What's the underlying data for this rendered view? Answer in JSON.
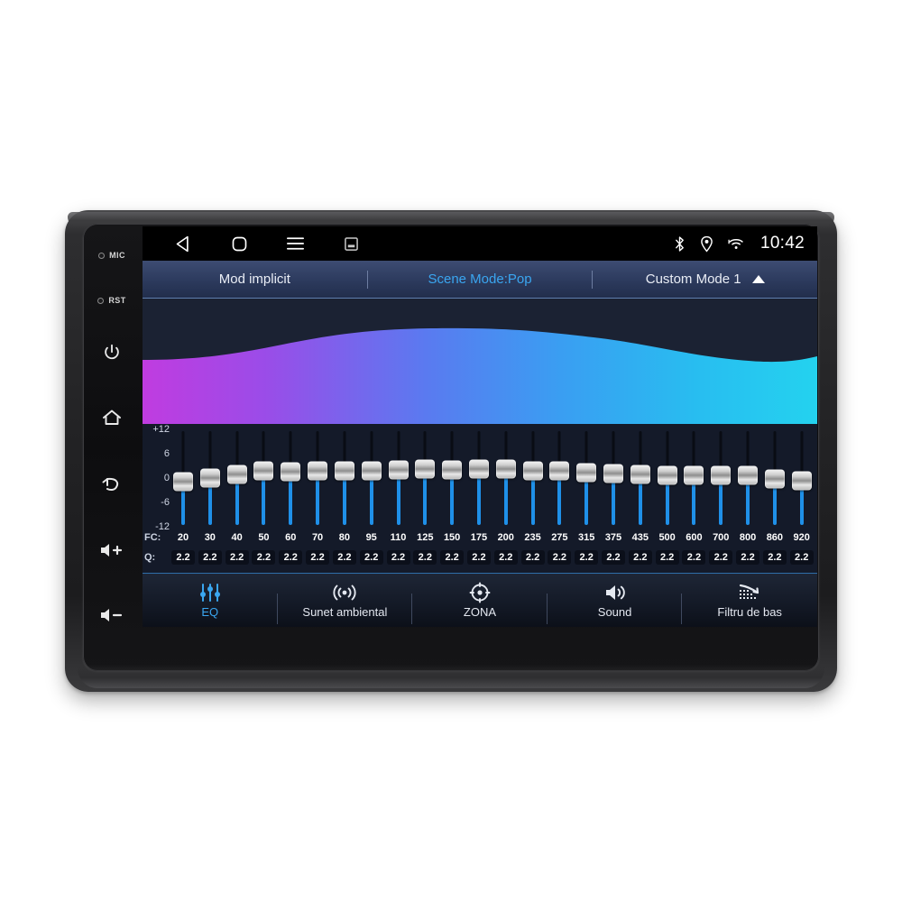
{
  "device": {
    "hardkeys": [
      {
        "name": "mic",
        "label": "MIC"
      },
      {
        "name": "reset",
        "label": "RST"
      },
      {
        "name": "power",
        "label": ""
      },
      {
        "name": "home",
        "label": ""
      },
      {
        "name": "back",
        "label": ""
      },
      {
        "name": "volume-up",
        "label": ""
      },
      {
        "name": "volume-down",
        "label": ""
      }
    ]
  },
  "status_bar": {
    "nav": [
      "back-triangle-icon",
      "home-square-icon",
      "menu-lines-icon",
      "screenshot-icon"
    ],
    "indicators": [
      "bluetooth-icon",
      "location-icon",
      "wifi-icon"
    ],
    "clock": "10:42"
  },
  "mode_bar": {
    "left_label": "Mod implicit",
    "center_label": "Scene Mode:Pop",
    "right_label": "Custom Mode 1",
    "caret": "caret-up-icon",
    "active_color": "#3aa6f0"
  },
  "spectrum": {
    "gradient_start": "#c03ce0",
    "gradient_mid": "#4f7ef0",
    "gradient_end": "#24c8ef",
    "background": "#1b2233"
  },
  "equalizer": {
    "scale_labels": [
      "+12",
      "6",
      "0",
      "-6",
      "-12"
    ],
    "fc_tag": "FC:",
    "q_tag": "Q:",
    "bands": [
      {
        "fc": "20",
        "q": "2.2",
        "gain": -1.0
      },
      {
        "fc": "30",
        "q": "2.2",
        "gain": 0.0
      },
      {
        "fc": "40",
        "q": "2.2",
        "gain": 1.0
      },
      {
        "fc": "50",
        "q": "2.2",
        "gain": 1.8
      },
      {
        "fc": "60",
        "q": "2.2",
        "gain": 1.6
      },
      {
        "fc": "70",
        "q": "2.2",
        "gain": 1.8
      },
      {
        "fc": "80",
        "q": "2.2",
        "gain": 1.9
      },
      {
        "fc": "95",
        "q": "2.2",
        "gain": 1.9
      },
      {
        "fc": "110",
        "q": "2.2",
        "gain": 2.0
      },
      {
        "fc": "125",
        "q": "2.2",
        "gain": 2.2
      },
      {
        "fc": "150",
        "q": "2.2",
        "gain": 2.1
      },
      {
        "fc": "175",
        "q": "2.2",
        "gain": 2.2
      },
      {
        "fc": "200",
        "q": "2.2",
        "gain": 2.4
      },
      {
        "fc": "235",
        "q": "2.2",
        "gain": 1.9
      },
      {
        "fc": "275",
        "q": "2.2",
        "gain": 1.8
      },
      {
        "fc": "315",
        "q": "2.2",
        "gain": 1.3
      },
      {
        "fc": "375",
        "q": "2.2",
        "gain": 1.2
      },
      {
        "fc": "435",
        "q": "2.2",
        "gain": 0.9
      },
      {
        "fc": "500",
        "q": "2.2",
        "gain": 0.8
      },
      {
        "fc": "600",
        "q": "2.2",
        "gain": 0.6
      },
      {
        "fc": "700",
        "q": "2.2",
        "gain": 0.7
      },
      {
        "fc": "800",
        "q": "2.2",
        "gain": 0.8
      },
      {
        "fc": "860",
        "q": "2.2",
        "gain": -0.2
      },
      {
        "fc": "920",
        "q": "2.2",
        "gain": -0.8
      }
    ],
    "track_color": "#1f90e8",
    "range": [
      -12,
      12
    ]
  },
  "tabs": [
    {
      "label": "EQ",
      "icon": "eq-sliders-icon",
      "active": true
    },
    {
      "label": "Sunet ambiental",
      "icon": "surround-waves-icon",
      "active": false
    },
    {
      "label": "ZONA",
      "icon": "zone-target-icon",
      "active": false
    },
    {
      "label": "Sound",
      "icon": "speaker-icon",
      "active": false
    },
    {
      "label": "Filtru de bas",
      "icon": "bass-filter-icon",
      "active": false
    }
  ]
}
